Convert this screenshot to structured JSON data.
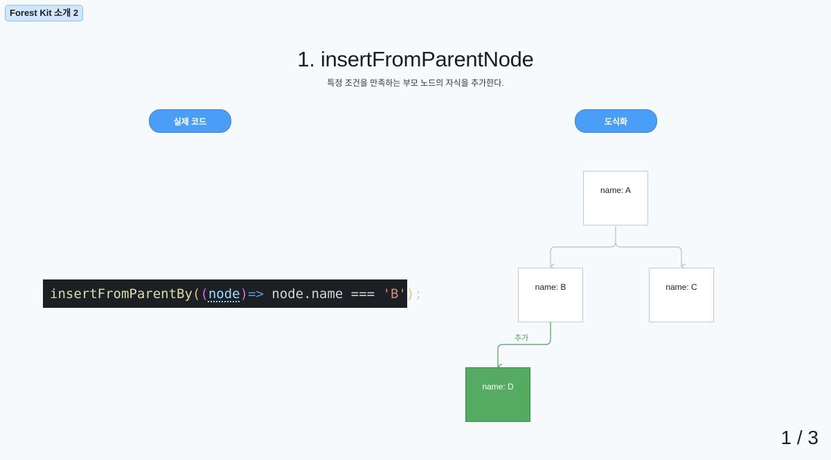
{
  "badge": "Forest Kit 소개 2",
  "slide": {
    "title": "1. insertFromParentNode",
    "subtitle": "특정 조건을 만족하는 부모 노드의 자식을 추가한다."
  },
  "buttons": {
    "code": "실제 코드",
    "visual": "도식화"
  },
  "code_line": {
    "fn": "insertFromParentBy",
    "open1": "(",
    "open2": "(",
    "param": "node",
    "close2": ")",
    "arrow": "=>",
    "expr": "node.name",
    "op": "===",
    "str": "'B'",
    "close1": ")",
    "semi": ";"
  },
  "tree": {
    "node_a": "name: A",
    "node_b": "name: B",
    "node_c": "name: C",
    "node_d": "name: D",
    "edge_label": "추가"
  },
  "pager": "1 / 3",
  "colors": {
    "accent": "#4b9ef5",
    "added_node": "#55ab62",
    "added_edge": "#4ea35a",
    "edge": "#b9bec4"
  }
}
